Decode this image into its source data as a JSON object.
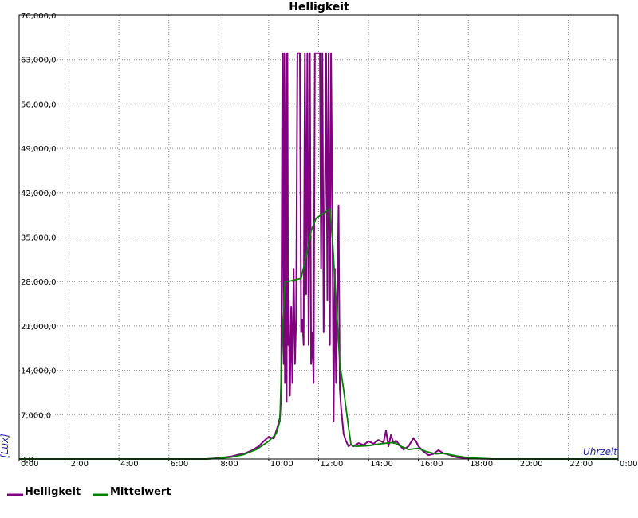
{
  "chart_data": {
    "type": "line",
    "title": "Helligkeit",
    "xlabel": "Uhrzeit",
    "ylabel": "[Lux]",
    "xlim": [
      0,
      24
    ],
    "ylim": [
      0,
      70000
    ],
    "grid": true,
    "legend_position": "bottom-left",
    "yticks": [
      {
        "value": 0,
        "label": "0,0"
      },
      {
        "value": 7000,
        "label": "7,000,0"
      },
      {
        "value": 14000,
        "label": "14,000,0"
      },
      {
        "value": 21000,
        "label": "21,000,0"
      },
      {
        "value": 28000,
        "label": "28,000,0"
      },
      {
        "value": 35000,
        "label": "35,000,0"
      },
      {
        "value": 42000,
        "label": "42,000,0"
      },
      {
        "value": 49000,
        "label": "49,000,0"
      },
      {
        "value": 56000,
        "label": "56,000,0"
      },
      {
        "value": 63000,
        "label": "63,000,0"
      },
      {
        "value": 70000,
        "label": "70,000,0"
      }
    ],
    "xticks": [
      {
        "value": 0,
        "label": "0:00"
      },
      {
        "value": 2,
        "label": "2:00"
      },
      {
        "value": 4,
        "label": "4:00"
      },
      {
        "value": 6,
        "label": "6:00"
      },
      {
        "value": 8,
        "label": "8:00"
      },
      {
        "value": 10,
        "label": "10:00"
      },
      {
        "value": 12,
        "label": "12:00"
      },
      {
        "value": 14,
        "label": "14:00"
      },
      {
        "value": 16,
        "label": "16:00"
      },
      {
        "value": 18,
        "label": "18:00"
      },
      {
        "value": 20,
        "label": "20:00"
      },
      {
        "value": 22,
        "label": "22:00"
      },
      {
        "value": 24,
        "label": "0:00"
      }
    ],
    "series": [
      {
        "name": "Helligkeit",
        "color": "#800080",
        "x": [
          0,
          7.5,
          8.0,
          8.5,
          8.8,
          9.0,
          9.3,
          9.6,
          9.8,
          10.0,
          10.2,
          10.35,
          10.45,
          10.5,
          10.55,
          10.6,
          10.62,
          10.65,
          10.7,
          10.72,
          10.75,
          10.78,
          10.8,
          10.85,
          10.9,
          10.95,
          11.0,
          11.05,
          11.1,
          11.15,
          11.2,
          11.25,
          11.3,
          11.35,
          11.4,
          11.45,
          11.5,
          11.55,
          11.6,
          11.65,
          11.7,
          11.75,
          11.8,
          11.85,
          11.9,
          11.95,
          12.0,
          12.05,
          12.1,
          12.15,
          12.2,
          12.25,
          12.3,
          12.35,
          12.4,
          12.45,
          12.5,
          12.55,
          12.6,
          12.65,
          12.7,
          12.75,
          12.8,
          12.85,
          12.9,
          13.0,
          13.1,
          13.2,
          13.3,
          13.4,
          13.6,
          13.8,
          14.0,
          14.2,
          14.4,
          14.6,
          14.7,
          14.8,
          14.9,
          15.0,
          15.1,
          15.2,
          15.4,
          15.6,
          15.8,
          15.9,
          16.0,
          16.2,
          16.4,
          16.6,
          16.8,
          17.0,
          17.2,
          17.5,
          18.0,
          19.0,
          24.0
        ],
        "y": [
          0,
          0,
          150,
          400,
          700,
          800,
          1300,
          2000,
          2800,
          3500,
          3200,
          5000,
          6500,
          10000,
          64000,
          15000,
          64000,
          12000,
          64000,
          9000,
          64000,
          18000,
          25000,
          10000,
          24000,
          12000,
          30000,
          15000,
          22000,
          64000,
          64000,
          64000,
          20000,
          22000,
          18000,
          64000,
          26000,
          64000,
          18000,
          64000,
          15000,
          20000,
          12000,
          64000,
          64000,
          64000,
          64000,
          64000,
          30000,
          64000,
          20000,
          40000,
          64000,
          25000,
          64000,
          18000,
          64000,
          40000,
          6000,
          30000,
          12000,
          25000,
          40000,
          11000,
          8000,
          4000,
          2800,
          2000,
          2300,
          2000,
          2500,
          2200,
          2800,
          2400,
          3000,
          2600,
          4500,
          2000,
          3800,
          2500,
          2900,
          2400,
          1500,
          2000,
          3300,
          2800,
          2000,
          1200,
          600,
          800,
          1400,
          900,
          700,
          300,
          100,
          0,
          0
        ]
      },
      {
        "name": "Mittelwert",
        "color": "#008000",
        "x": [
          0,
          7.5,
          8.0,
          8.5,
          9.0,
          9.5,
          10.0,
          10.3,
          10.45,
          10.55,
          10.65,
          10.75,
          11.0,
          11.3,
          11.5,
          11.7,
          11.9,
          12.1,
          12.3,
          12.45,
          12.55,
          12.7,
          12.85,
          13.0,
          13.2,
          13.3,
          13.5,
          14.0,
          14.5,
          15.0,
          15.3,
          15.6,
          16.0,
          16.3,
          16.7,
          17.0,
          17.5,
          18.0,
          19.0,
          24.0
        ],
        "y": [
          0,
          0,
          100,
          300,
          700,
          1500,
          2800,
          4000,
          6000,
          20000,
          28000,
          28000,
          28200,
          28500,
          32000,
          36000,
          38000,
          38500,
          39000,
          39500,
          35000,
          25000,
          15000,
          11000,
          5000,
          2200,
          2000,
          2100,
          2400,
          2600,
          2000,
          1500,
          1700,
          1200,
          800,
          900,
          500,
          200,
          0,
          0
        ]
      }
    ]
  }
}
